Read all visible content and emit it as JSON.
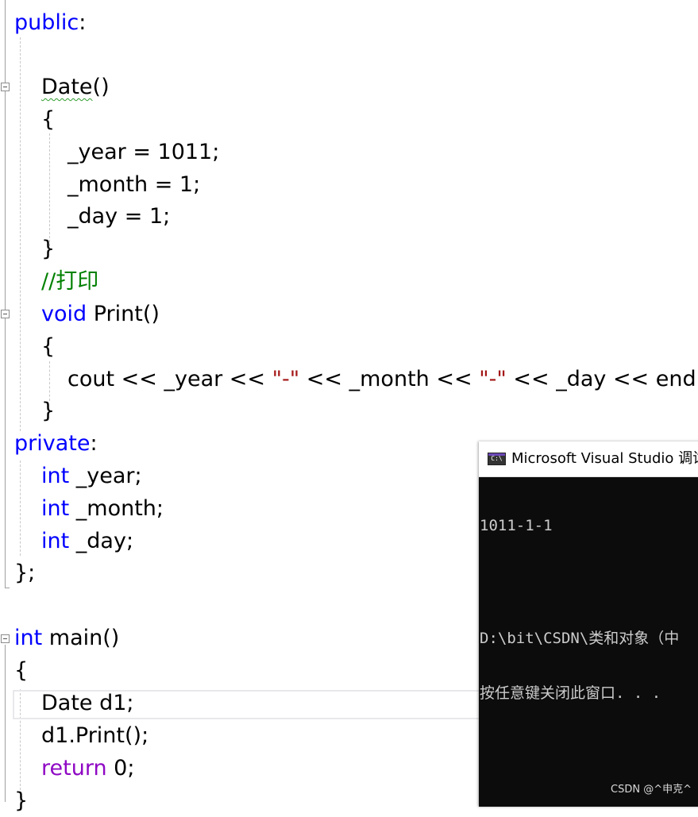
{
  "code": {
    "lines": [
      [
        {
          "t": "public",
          "c": "kw"
        },
        {
          "t": ":"
        }
      ],
      [],
      [
        {
          "t": "Date",
          "c": "squiggle"
        },
        {
          "t": "()"
        }
      ],
      [
        {
          "t": "{"
        }
      ],
      [
        {
          "t": "_year = 1011;"
        }
      ],
      [
        {
          "t": "_month = 1;"
        }
      ],
      [
        {
          "t": "_day = 1;"
        }
      ],
      [
        {
          "t": "}"
        }
      ],
      [
        {
          "t": "//打印",
          "c": "cm"
        }
      ],
      [
        {
          "t": "void",
          "c": "kw"
        },
        {
          "t": " Print()"
        }
      ],
      [
        {
          "t": "{"
        }
      ],
      [
        {
          "t": "cout << _year << "
        },
        {
          "t": "\"-\"",
          "c": "str"
        },
        {
          "t": " << _month << "
        },
        {
          "t": "\"-\"",
          "c": "str"
        },
        {
          "t": " << _day << endl;"
        }
      ],
      [
        {
          "t": "}"
        }
      ],
      [
        {
          "t": "private",
          "c": "kw"
        },
        {
          "t": ":"
        }
      ],
      [
        {
          "t": "int",
          "c": "kw"
        },
        {
          "t": " _year;"
        }
      ],
      [
        {
          "t": "int",
          "c": "kw"
        },
        {
          "t": " _month;"
        }
      ],
      [
        {
          "t": "int",
          "c": "kw"
        },
        {
          "t": " _day;"
        }
      ],
      [
        {
          "t": "};"
        }
      ],
      [],
      [
        {
          "t": "int",
          "c": "kw"
        },
        {
          "t": " main()"
        }
      ],
      [
        {
          "t": "{"
        }
      ],
      [
        {
          "t": "Date d1;"
        }
      ],
      [
        {
          "t": "d1.Print();"
        }
      ],
      [
        {
          "t": "return",
          "c": "kw2"
        },
        {
          "t": " 0;"
        }
      ],
      [
        {
          "t": "}"
        }
      ]
    ]
  },
  "console": {
    "title": "Microsoft Visual Studio 调试",
    "output": [
      "1011-1-1",
      "",
      "D:\\bit\\CSDN\\类和对象（中",
      "按任意键关闭此窗口. . ."
    ]
  },
  "watermark": "CSDN @^申克^"
}
